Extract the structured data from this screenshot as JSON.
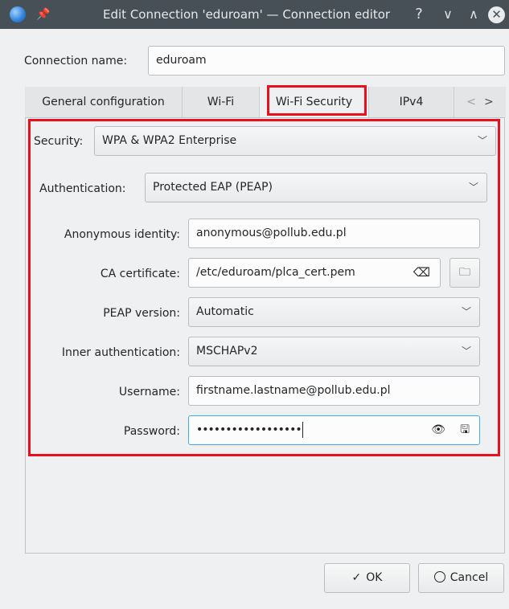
{
  "window": {
    "title": "Edit Connection 'eduroam' — Connection editor",
    "help_glyph": "?",
    "minimize_glyph": "∨",
    "maximize_glyph": "∧",
    "close_glyph": "✕",
    "pin_glyph": "📌"
  },
  "connection": {
    "name_label": "Connection name:",
    "name_value": "eduroam"
  },
  "tabs": [
    {
      "label": "General configuration"
    },
    {
      "label": "Wi-Fi"
    },
    {
      "label": "Wi-Fi Security"
    },
    {
      "label": "IPv4"
    }
  ],
  "tab_scroll": {
    "left": "<",
    "right": ">"
  },
  "security": {
    "security_label": "Security:",
    "security_value": "WPA & WPA2 Enterprise",
    "auth_label": "Authentication:",
    "auth_value": "Protected EAP (PEAP)",
    "anon_label": "Anonymous identity:",
    "anon_value": "anonymous@pollub.edu.pl",
    "ca_label": "CA certificate:",
    "ca_value": "/etc/eduroam/plca_cert.pem",
    "peap_label": "PEAP version:",
    "peap_value": "Automatic",
    "inner_label": "Inner authentication:",
    "inner_value": "MSCHAPv2",
    "user_label": "Username:",
    "user_value": "firstname.lastname@pollub.edu.pl",
    "pass_label": "Password:",
    "pass_value": "••••••••••••••••••"
  },
  "icons": {
    "chevron": "﹀",
    "clear": "⌫",
    "folder": "🗀",
    "eye": "👁",
    "save": "🖫"
  },
  "buttons": {
    "ok_label": "OK",
    "ok_glyph": "✓",
    "cancel_label": "Cancel",
    "cancel_glyph": "⃠"
  },
  "colors": {
    "highlight": "#e8101c",
    "titlebar": "#475057"
  }
}
